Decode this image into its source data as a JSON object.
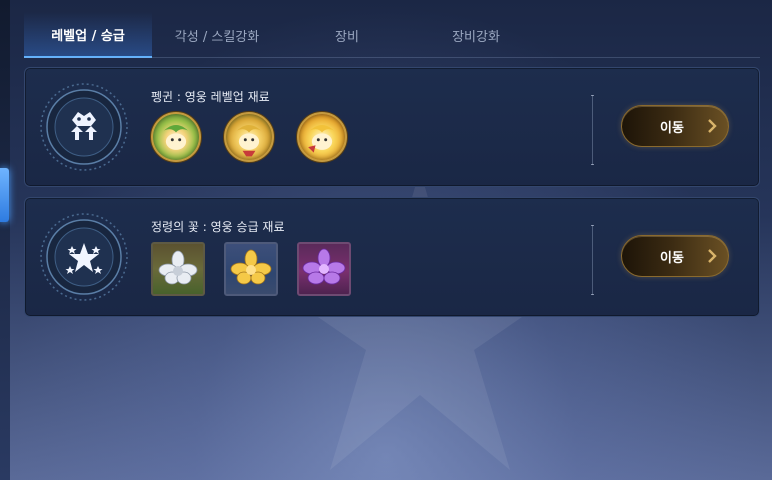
{
  "tabs": [
    {
      "label": "레벨업 / 승급",
      "active": true
    },
    {
      "label": "각성 / 스킬강화",
      "active": false
    },
    {
      "label": "장비",
      "active": false
    },
    {
      "label": "장비강화",
      "active": false
    }
  ],
  "cards": [
    {
      "title": "펭귄 : 영웅 레벨업 재료",
      "emblem_icon": "level-up-penguin-icon",
      "items": [
        "green-penguin-item-icon",
        "yellow-penguin-item-icon",
        "gold-penguin-item-icon"
      ],
      "button_label": "이동"
    },
    {
      "title": "정령의 꽃 : 영웅 승급 재료",
      "emblem_icon": "star-promotion-icon",
      "items": [
        "silver-flower-item-icon",
        "gold-flower-item-icon",
        "purple-flower-item-icon"
      ],
      "button_label": "이동"
    }
  ],
  "colors": {
    "accent_tab": "#5fb2ff",
    "button_gold": "#8a6a2e",
    "card_bg": "#1d2d4d"
  }
}
